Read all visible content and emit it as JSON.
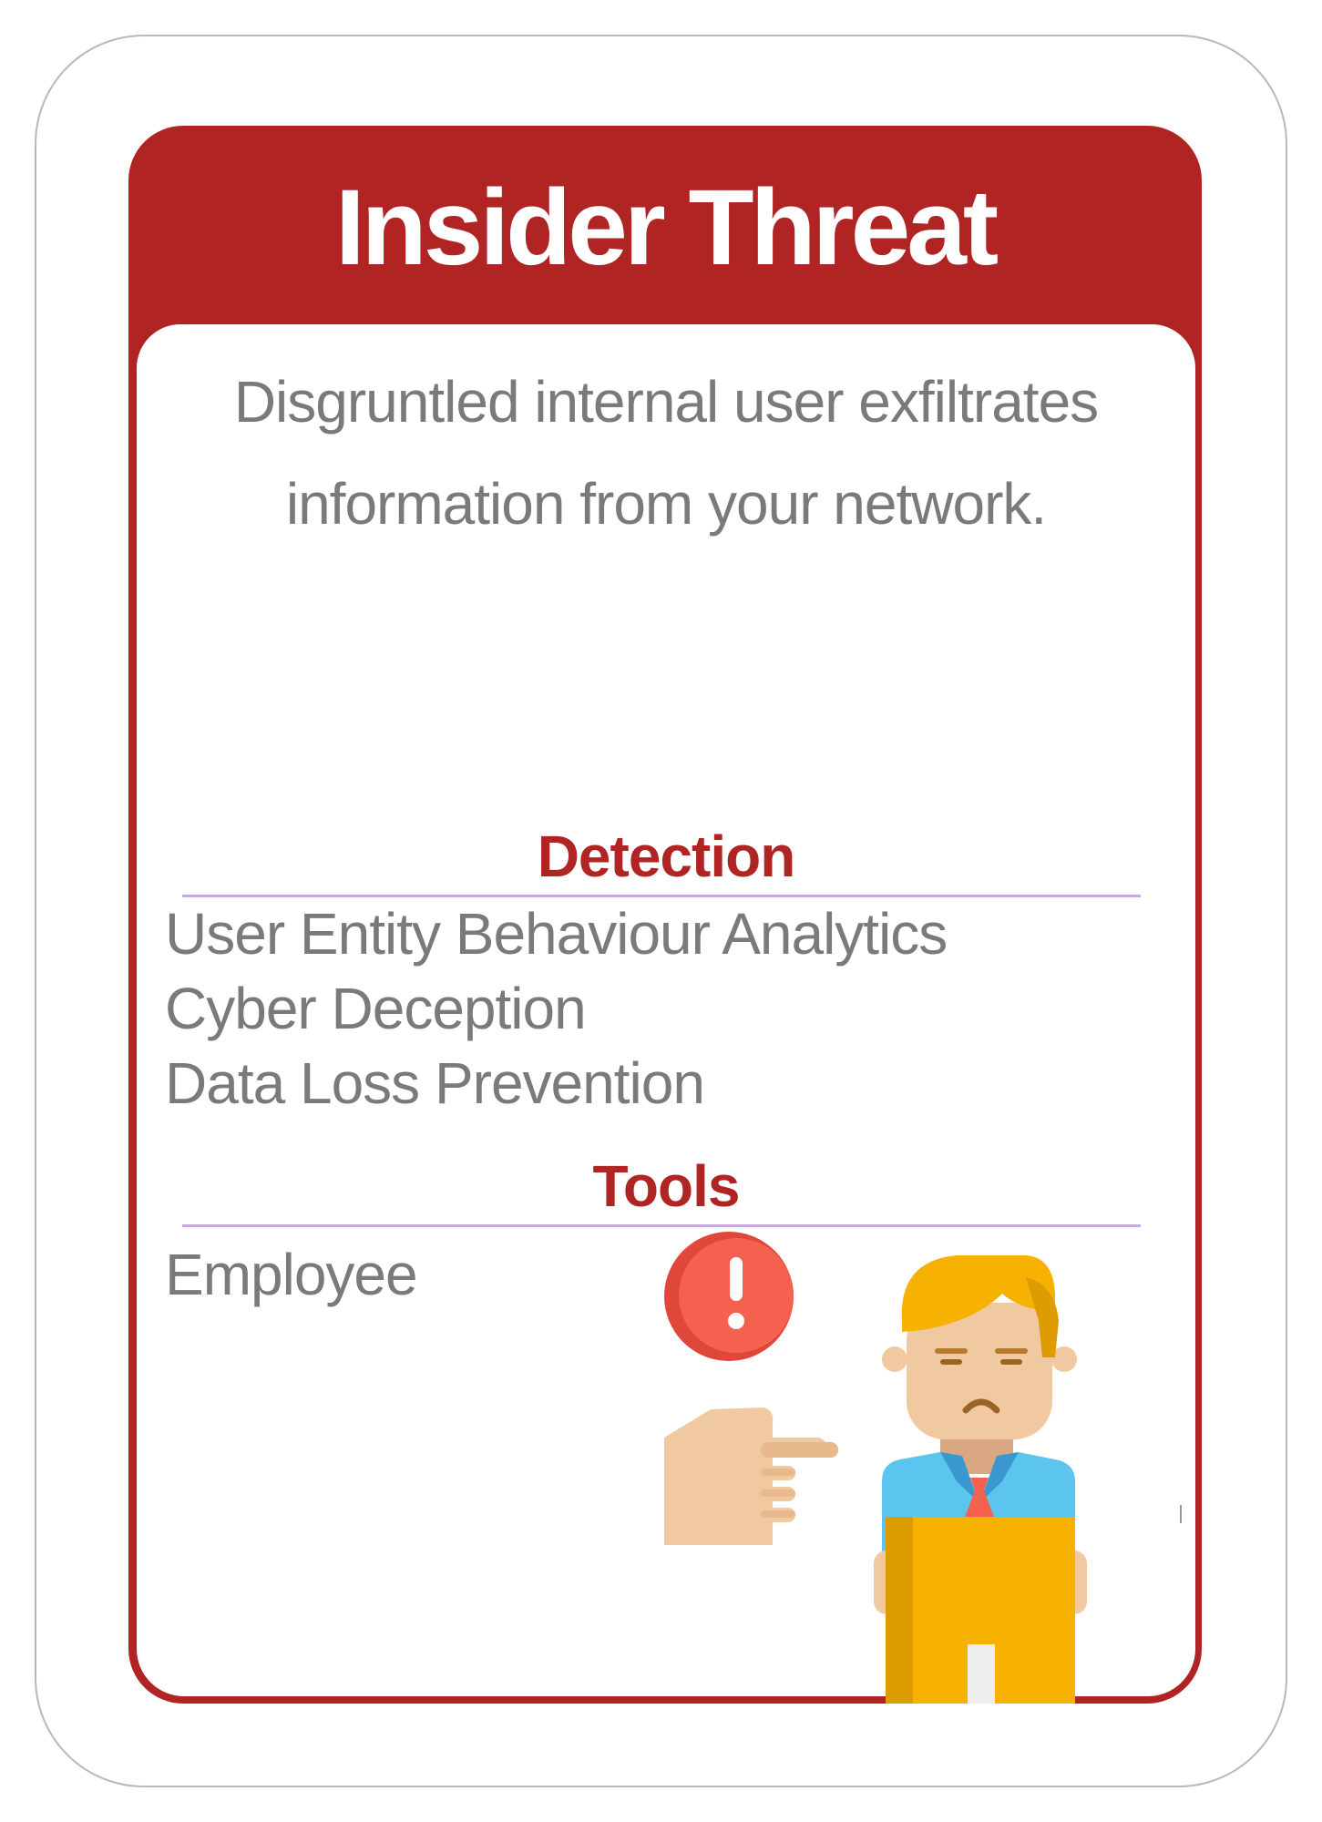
{
  "card": {
    "title": "Insider Threat",
    "description_line1": "Disgruntled internal user exfiltrates",
    "description_line2": "information from your network.",
    "detection": {
      "heading": "Detection",
      "items": [
        "User Entity Behaviour Analytics",
        "Cyber Deception",
        "Data Loss Prevention"
      ]
    },
    "tools": {
      "heading": "Tools",
      "items": [
        "Employee"
      ]
    },
    "illustration_icon": "insider-employee-pointing-hand-alert-icon"
  },
  "colors": {
    "accent_red": "#b02424",
    "text_gray": "#7a7a7a",
    "divider_lavender": "#c9a9e4",
    "alert_red": "#f4614f",
    "hair_yellow": "#f7b100",
    "shirt_blue": "#5cc5ee",
    "skin": "#f0c9a0",
    "box_yellow": "#f7b100"
  }
}
